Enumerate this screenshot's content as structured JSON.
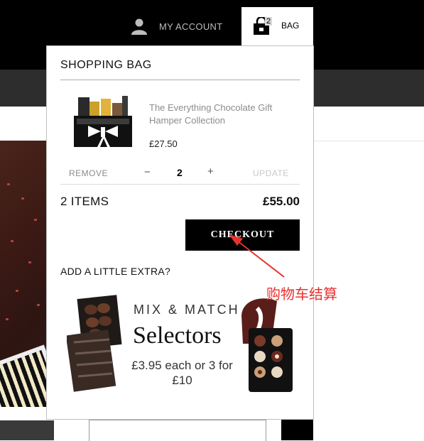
{
  "header": {
    "account_label": "MY ACCOUNT",
    "bag_label": "BAG",
    "bag_count": "2"
  },
  "bag": {
    "title": "SHOPPING BAG",
    "item": {
      "name": "The Everything Chocolate Gift Hamper Collection",
      "price": "£27.50",
      "quantity": "2",
      "remove_label": "REMOVE",
      "minus_label": "−",
      "plus_label": "+",
      "update_label": "UPDATE"
    },
    "summary_items": "2 ITEMS",
    "summary_total": "£55.00",
    "checkout_label": "CHECKOUT",
    "extra_title": "ADD A LITTLE EXTRA?",
    "promo": {
      "line1": "MIX & MATCH",
      "line2": "Selectors",
      "line3": "£3.95 each or 3 for £10"
    }
  },
  "annotation": {
    "text": "购物车结算",
    "color": "#e8322f"
  },
  "colors": {
    "topbar": "#000000",
    "navbar": "#2d2d2d",
    "checkout_bg": "#000000"
  }
}
